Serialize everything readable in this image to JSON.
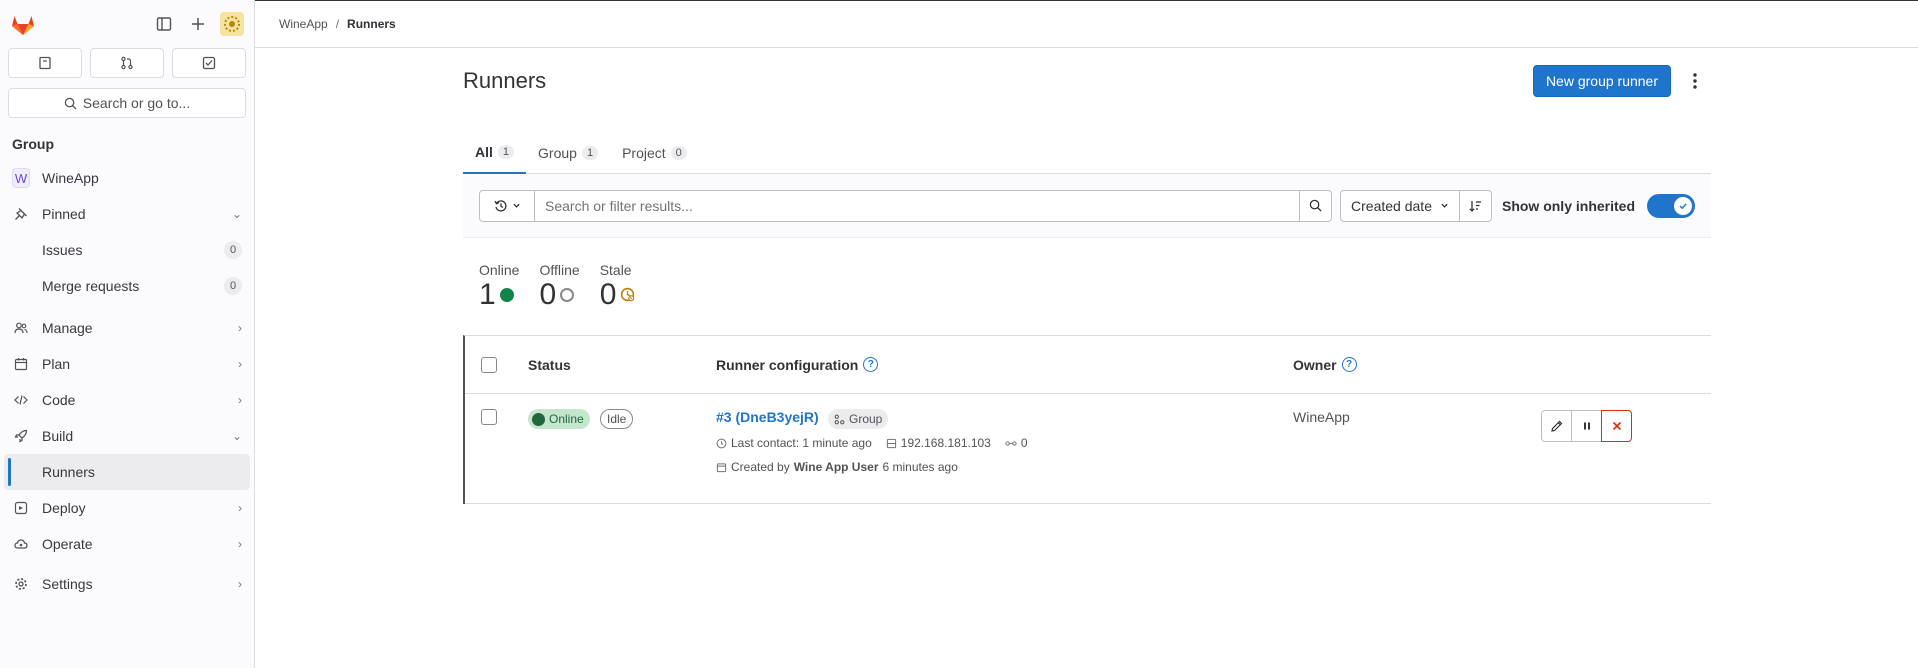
{
  "sidebar": {
    "search_label": "Search or go to...",
    "section_label": "Group",
    "group": {
      "initial": "W",
      "name": "WineApp"
    },
    "pinned": {
      "label": "Pinned"
    },
    "pinned_items": [
      {
        "label": "Issues",
        "count": "0"
      },
      {
        "label": "Merge requests",
        "count": "0"
      }
    ],
    "manage": "Manage",
    "plan": "Plan",
    "code": "Code",
    "build": "Build",
    "runners": "Runners",
    "deploy": "Deploy",
    "operate": "Operate",
    "settings": "Settings"
  },
  "breadcrumb": {
    "parent": "WineApp",
    "current": "Runners",
    "separator": "/"
  },
  "page": {
    "title": "Runners",
    "new_runner_button": "New group runner"
  },
  "tabs": [
    {
      "label": "All",
      "count": "1"
    },
    {
      "label": "Group",
      "count": "1"
    },
    {
      "label": "Project",
      "count": "0"
    }
  ],
  "filter": {
    "placeholder": "Search or filter results...",
    "sort_label": "Created date",
    "inherit_label": "Show only inherited",
    "inherit_enabled": true
  },
  "stats": [
    {
      "label": "Online",
      "value": "1"
    },
    {
      "label": "Offline",
      "value": "0"
    },
    {
      "label": "Stale",
      "value": "0"
    }
  ],
  "table": {
    "headers": {
      "status": "Status",
      "config": "Runner configuration",
      "owner": "Owner"
    },
    "rows": [
      {
        "status": "Online",
        "state": "Idle",
        "name": "#3 (DneB3yejR)",
        "type": "Group",
        "last_contact": "Last contact: 1 minute ago",
        "ip": "192.168.181.103",
        "jobs": "0",
        "created_prefix": "Created by",
        "created_by": "Wine App User",
        "created_ago": "6 minutes ago",
        "owner": "WineApp"
      }
    ]
  },
  "colors": {
    "accent": "#1f75cb",
    "online": "#108548",
    "stale": "#c17d10",
    "danger": "#dd2b0e"
  }
}
